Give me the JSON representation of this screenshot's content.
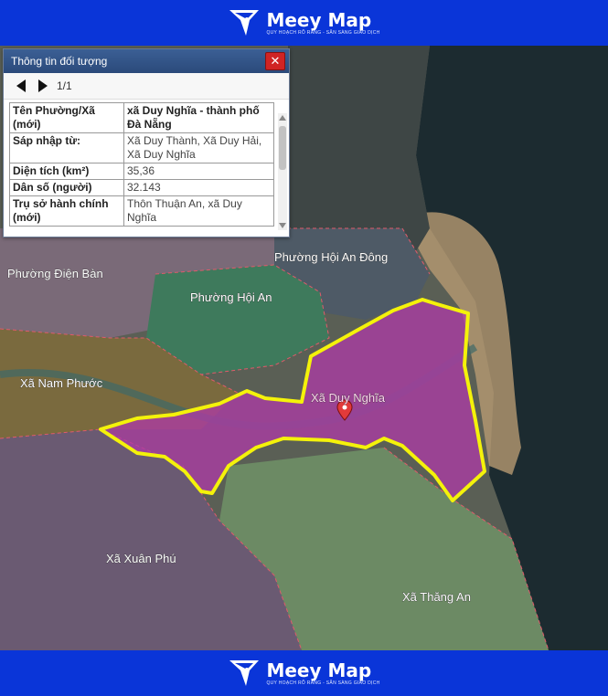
{
  "brand": {
    "name": "Meey Map",
    "tagline": "QUY HOẠCH RÕ RÀNG - SẴN SÀNG GIAO DỊCH"
  },
  "panel": {
    "title": "Thông tin đối tượng",
    "pager": "1/1",
    "rows": [
      {
        "key": "Tên Phường/Xã (mới)",
        "value": "xã Duy Nghĩa - thành phố Đà Nẵng"
      },
      {
        "key": "Sáp nhập từ:",
        "value": "Xã Duy Thành, Xã Duy Hải, Xã Duy Nghĩa"
      },
      {
        "key": "Diện tích (km²)",
        "value": "35,36"
      },
      {
        "key": "Dân số (người)",
        "value": "32.143"
      },
      {
        "key": "Trụ sở hành chính (mới)",
        "value": "Thôn Thuận An, xã Duy Nghĩa"
      }
    ]
  },
  "map": {
    "labels": {
      "hoi_an_dong": "Phường Hội An Đông",
      "dien_ban": "Phường Điện Bàn",
      "hoi_an": "Phường Hội An",
      "nam_phuoc": "Xã Nam Phước",
      "duy_nghia": "Xã Duy Nghĩa",
      "xuan_phu": "Xã Xuân Phú",
      "thang_an": "Xã Thăng An"
    },
    "colors": {
      "selected_fill": "#b03aa8",
      "selected_border": "#f4f20a",
      "marker": "#e23a3a",
      "banner": "#0a35d8"
    }
  }
}
